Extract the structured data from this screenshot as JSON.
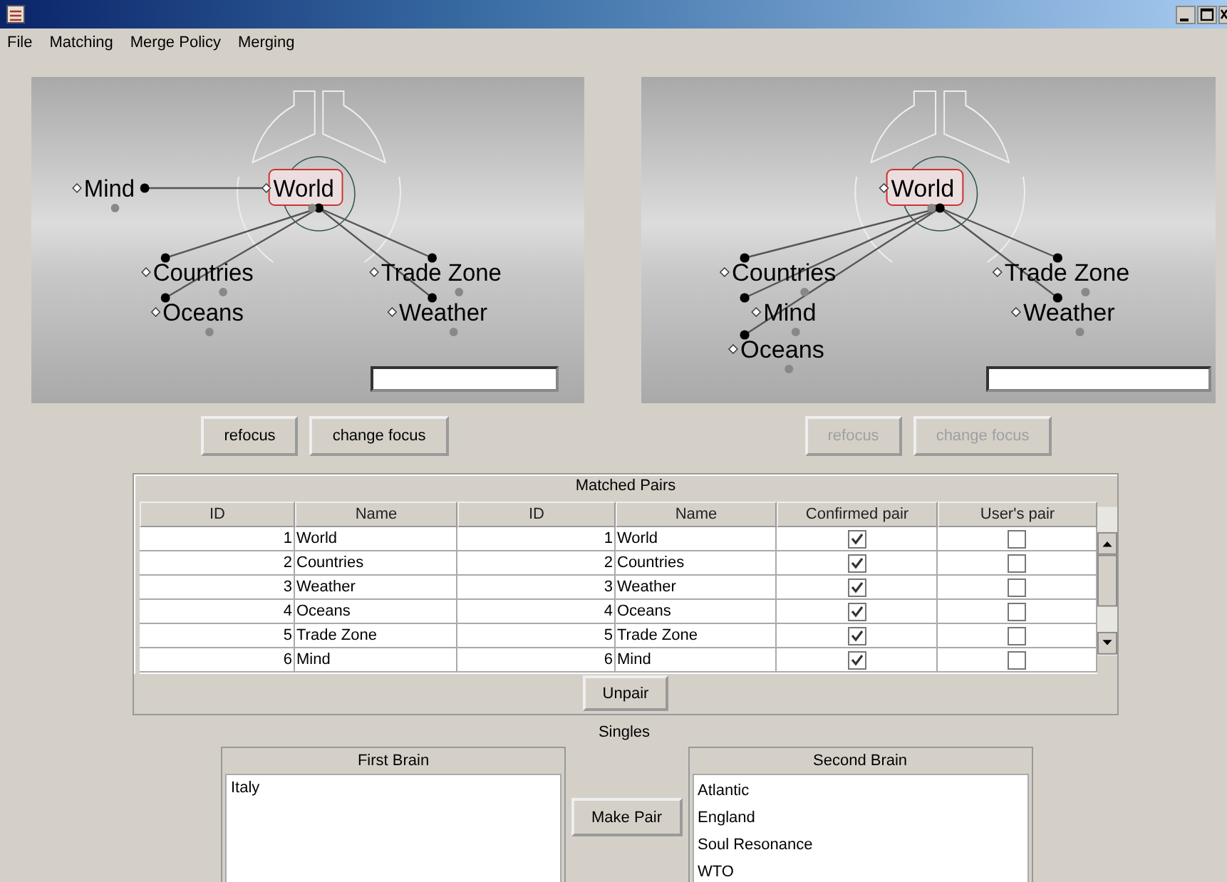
{
  "menu": [
    "File",
    "Matching",
    "Merge Policy",
    "Merging"
  ],
  "graphs": [
    {
      "nodes": [
        {
          "label": "World",
          "focused": true
        },
        {
          "label": "Mind",
          "focused": false
        },
        {
          "label": "Countries",
          "focused": false
        },
        {
          "label": "Oceans",
          "focused": false
        },
        {
          "label": "Trade Zone",
          "focused": false
        },
        {
          "label": "Weather",
          "focused": false
        }
      ],
      "buttons": [
        {
          "label": "refocus",
          "disabled": false
        },
        {
          "label": "change focus",
          "disabled": false
        }
      ]
    },
    {
      "nodes": [
        {
          "label": "World",
          "focused": true
        },
        {
          "label": "Countries",
          "focused": false
        },
        {
          "label": "Mind",
          "focused": false
        },
        {
          "label": "Oceans",
          "focused": false
        },
        {
          "label": "Trade Zone",
          "focused": false
        },
        {
          "label": "Weather",
          "focused": false
        }
      ],
      "buttons": [
        {
          "label": "refocus",
          "disabled": true
        },
        {
          "label": "change focus",
          "disabled": true
        }
      ]
    }
  ],
  "matched_pairs": {
    "title": "Matched Pairs",
    "columns": [
      "ID",
      "Name",
      "ID",
      "Name",
      "Confirmed pair",
      "User's pair"
    ],
    "rows": [
      {
        "id_1": "1",
        "name_1": "World",
        "id_2": "1",
        "name_2": "World",
        "confirmed": true,
        "users": false
      },
      {
        "id_1": "2",
        "name_1": "Countries",
        "id_2": "2",
        "name_2": "Countries",
        "confirmed": true,
        "users": false
      },
      {
        "id_1": "3",
        "name_1": "Weather",
        "id_2": "3",
        "name_2": "Weather",
        "confirmed": true,
        "users": false
      },
      {
        "id_1": "4",
        "name_1": "Oceans",
        "id_2": "4",
        "name_2": "Oceans",
        "confirmed": true,
        "users": false
      },
      {
        "id_1": "5",
        "name_1": "Trade Zone",
        "id_2": "5",
        "name_2": "Trade Zone",
        "confirmed": true,
        "users": false
      },
      {
        "id_1": "6",
        "name_1": "Mind",
        "id_2": "6",
        "name_2": "Mind",
        "confirmed": true,
        "users": false
      }
    ],
    "unpair": "Unpair"
  },
  "singles": {
    "title": "Singles",
    "first": {
      "title": "First Brain",
      "items": [
        "Italy"
      ]
    },
    "make_pair": "Make Pair",
    "second": {
      "title": "Second Brain",
      "items": [
        "Atlantic",
        "England",
        "Soul Resonance",
        "WTO"
      ]
    }
  }
}
